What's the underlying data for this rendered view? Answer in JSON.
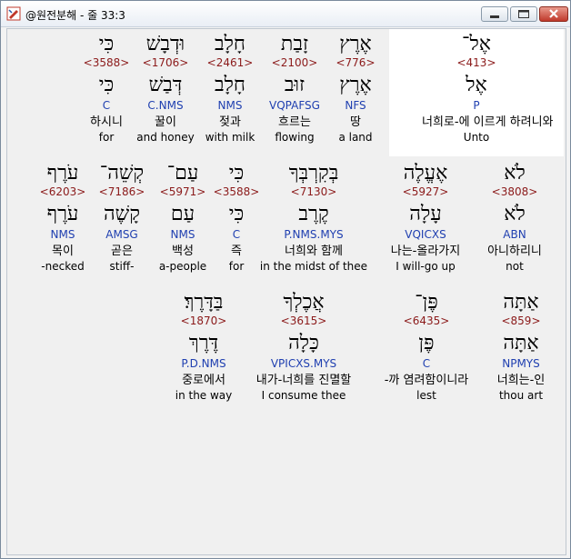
{
  "window": {
    "title": "@원전분해 - 줄 33:3"
  },
  "rows": [
    [
      {
        "heb": "אֶל־",
        "num": "<413>",
        "lex": "אֶל",
        "pars": "P",
        "kor": "너희로-에 이르게 하려니와",
        "eng": "Unto"
      },
      {
        "heb": "אֶרֶץ",
        "num": "<776>",
        "lex": "אֶרֶץ",
        "pars": "NFS",
        "kor": "땅",
        "eng": "a land"
      },
      {
        "heb": "זָבַת",
        "num": "<2100>",
        "lex": "זוּב",
        "pars": "VQPAFSG",
        "kor": "흐르는",
        "eng": "flowing"
      },
      {
        "heb": "חָלָב",
        "num": "<2461>",
        "lex": "חָלָב",
        "pars": "NMS",
        "kor": "젖과",
        "eng": "with milk"
      },
      {
        "heb": "וּדְבָשׁ",
        "num": "<1706>",
        "lex": "דְּבַשׁ",
        "pars": "C.NMS",
        "kor": "꿀이",
        "eng": "and honey"
      },
      {
        "heb": "כִּי",
        "num": "<3588>",
        "lex": "כִּי",
        "pars": "C",
        "kor": "하시니",
        "eng": "for"
      }
    ],
    [
      {
        "heb": "לֹא",
        "num": "<3808>",
        "lex": "לֹא",
        "pars": "ABN",
        "kor": "아니하리니",
        "eng": "not"
      },
      {
        "heb": "אֶעֱלֶה",
        "num": "<5927>",
        "lex": "עָלָה",
        "pars": "VQICXS",
        "kor": "나는-올라가지",
        "eng": "I will-go up"
      },
      {
        "heb": "בְּקִרְבְּךָ",
        "num": "<7130>",
        "lex": "קֶרֶב",
        "pars": "P.NMS.MYS",
        "kor": "너희와 함께",
        "eng": "in the midst of thee"
      },
      {
        "heb": "כִּי",
        "num": "<3588>",
        "lex": "כִּי",
        "pars": "C",
        "kor": "즉",
        "eng": "for"
      },
      {
        "heb": "עַם־",
        "num": "<5971>",
        "lex": "עַם",
        "pars": "NMS",
        "kor": "백성",
        "eng": "a-people"
      },
      {
        "heb": "קְשֵׁה־",
        "num": "<7186>",
        "lex": "קָשֶׁה",
        "pars": "AMSG",
        "kor": "곧은",
        "eng": "stiff-"
      },
      {
        "heb": "עֹרֶף",
        "num": "<6203>",
        "lex": "עֹרֶף",
        "pars": "NMS",
        "kor": "목이",
        "eng": "-necked"
      }
    ],
    [
      {
        "heb": "אַתָּה",
        "num": "<859>",
        "lex": "אַתָּה",
        "pars": "NPMYS",
        "kor": "너희는-인",
        "eng": "thou art"
      },
      {
        "heb": "פֶּן־",
        "num": "<6435>",
        "lex": "פֶּן",
        "pars": "C",
        "kor": "-까 염려함이니라",
        "eng": "lest"
      },
      {
        "heb": "אֲכֶלְךָ",
        "num": "<3615>",
        "lex": "כָּלָה",
        "pars": "VPICXS.MYS",
        "kor": "내가-너희를 진멸할",
        "eng": "I consume thee"
      },
      {
        "heb": "בַּדָּרֶךְ׃",
        "num": "<1870>",
        "lex": "דֶּרֶךְ",
        "pars": "P.D.NMS",
        "kor": "중로에서",
        "eng": "in the way"
      }
    ]
  ]
}
